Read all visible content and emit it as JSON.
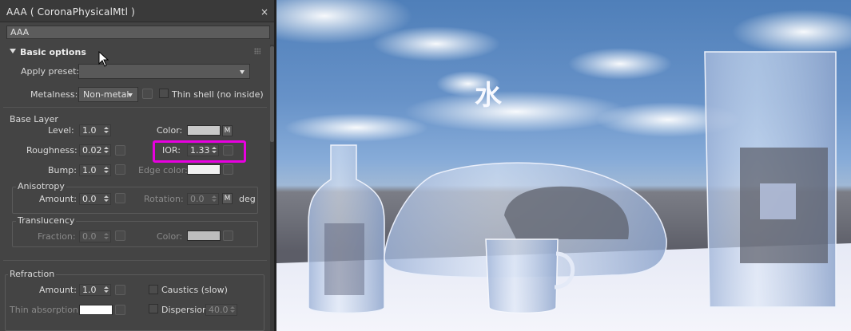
{
  "window": {
    "title": "AAA  ( CoronaPhysicalMtl )",
    "close_glyph": "×"
  },
  "material_name": "AAA",
  "basic_options": {
    "title": "Basic options",
    "apply_preset_label": "Apply preset:",
    "apply_preset_value": "",
    "metalness_label": "Metalness:",
    "metalness_value": "Non-metal",
    "thin_shell_label": "Thin shell (no inside)"
  },
  "base_layer": {
    "title": "Base Layer",
    "level_label": "Level:",
    "level_value": "1.0",
    "color_label": "Color:",
    "color_swatch": "#c9c9c9",
    "roughness_label": "Roughness:",
    "roughness_value": "0.02",
    "ior_label": "IOR:",
    "ior_value": "1.33",
    "bump_label": "Bump:",
    "bump_value": "1.0",
    "edge_color_label": "Edge color:",
    "edge_color_swatch": "#f0f0f0",
    "m_label": "M"
  },
  "anisotropy": {
    "title": "Anisotropy",
    "amount_label": "Amount:",
    "amount_value": "0.0",
    "rotation_label": "Rotation:",
    "rotation_value": "0.0",
    "unit": "deg"
  },
  "translucency": {
    "title": "Translucency",
    "fraction_label": "Fraction:",
    "fraction_value": "0.0",
    "color_label": "Color:",
    "color_swatch": "#bdbdbd"
  },
  "refraction": {
    "title": "Refraction",
    "amount_label": "Amount:",
    "amount_value": "1.0",
    "caustics_label": "Caustics (slow)",
    "thin_absorption_label": "Thin absorption:",
    "thin_absorption_swatch": "#ffffff",
    "dispersion_label": "Dispersion",
    "dispersion_value": "40.0"
  },
  "render": {
    "overlay_text": "水"
  },
  "colors": {
    "highlight": "#e800e0",
    "panel_bg": "#444444"
  }
}
